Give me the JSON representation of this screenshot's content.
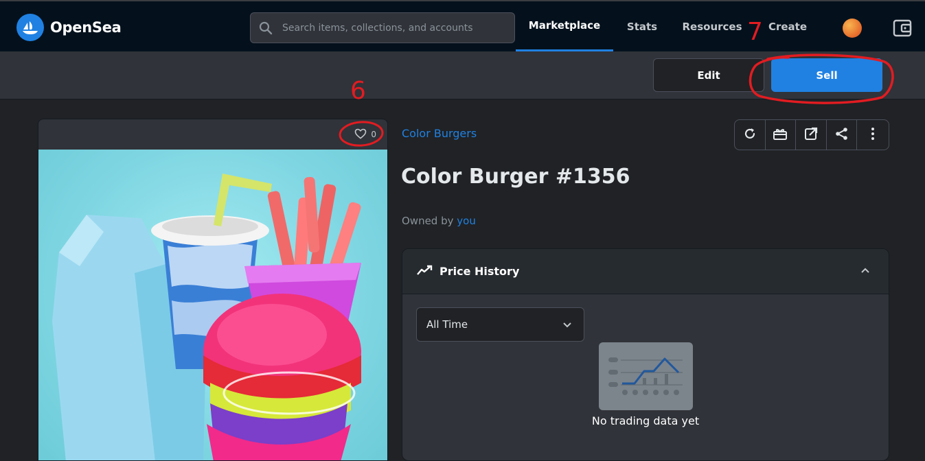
{
  "app": {
    "name": "OpenSea",
    "brand_color": "#2081e2"
  },
  "search": {
    "placeholder": "Search items, collections, and accounts"
  },
  "nav": {
    "items": [
      {
        "label": "Marketplace",
        "active": true
      },
      {
        "label": "Stats"
      },
      {
        "label": "Resources"
      },
      {
        "label": "Create"
      }
    ]
  },
  "actions": {
    "edit_label": "Edit",
    "sell_label": "Sell"
  },
  "item": {
    "favorites_count": "0",
    "collection": "Color Burgers",
    "title": "Color Burger #1356",
    "owned_by_label": "Owned by",
    "owner": "you"
  },
  "toolbar": {
    "icons": [
      "refresh-icon",
      "gift-icon",
      "external-link-icon",
      "share-icon",
      "more-icon"
    ]
  },
  "price_history": {
    "title": "Price History",
    "range_selected": "All Time",
    "empty_message": "No trading data yet"
  },
  "annotations": {
    "six": "6",
    "seven": "7",
    "color": "#e21c21"
  }
}
